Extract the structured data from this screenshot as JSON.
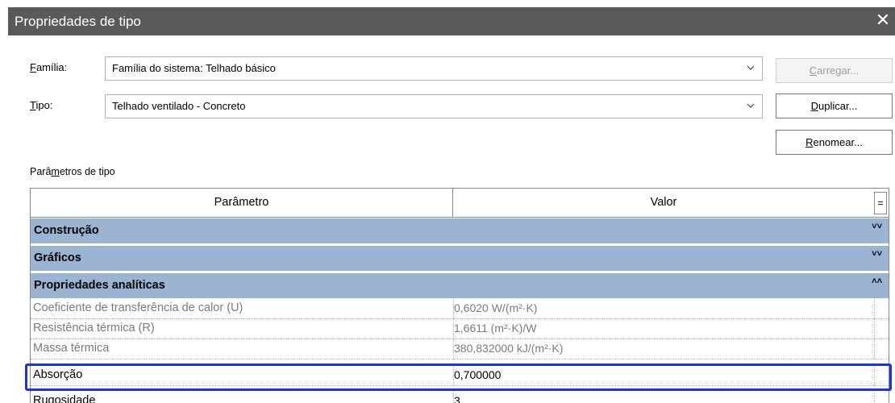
{
  "window": {
    "title": "Propriedades de tipo",
    "close_icon": "close-icon"
  },
  "familia": {
    "label_underlined": "F",
    "label_rest": "amília:",
    "value": "Família do sistema: Telhado básico"
  },
  "tipo": {
    "label_underlined": "T",
    "label_rest": "ipo:",
    "value": "Telhado ventilado - Concreto"
  },
  "buttons": {
    "carregar_u": "C",
    "carregar_rest": "arregar...",
    "duplicar_u": "D",
    "duplicar_rest": "uplicar...",
    "renomear_u": "R",
    "renomear_rest": "enomear..."
  },
  "params_section": {
    "label_pre": "Parâ",
    "label_u": "m",
    "label_post": "etros de tipo"
  },
  "grid": {
    "col_param": "Parâmetro",
    "col_value": "Valor",
    "eq_button": "=",
    "groups": [
      {
        "name": "Construção",
        "state": "collapsed",
        "chevron": "˅˅"
      },
      {
        "name": "Gráficos",
        "state": "collapsed",
        "chevron": "˅˅"
      },
      {
        "name": "Propriedades analíticas",
        "state": "expanded",
        "chevron": "˄˄"
      }
    ],
    "rows": [
      {
        "param": "Coeficiente de transferência de calor (U)",
        "value": "0,6020 W/(m²·K)",
        "editable": false
      },
      {
        "param": "Resistência térmica (R)",
        "value": "1,6611 (m²·K)/W",
        "editable": false
      },
      {
        "param": "Massa térmica",
        "value": "380,832000 kJ/(m²·K)",
        "editable": false
      },
      {
        "param": "Absorção",
        "value": "0,700000",
        "editable": true
      },
      {
        "param": "Rugosidade",
        "value": "3",
        "editable": true
      }
    ]
  },
  "colors": {
    "titlebar": "#5a5a5a",
    "group_header": "#9bb4d2",
    "highlight_box": "#1a33e0"
  }
}
